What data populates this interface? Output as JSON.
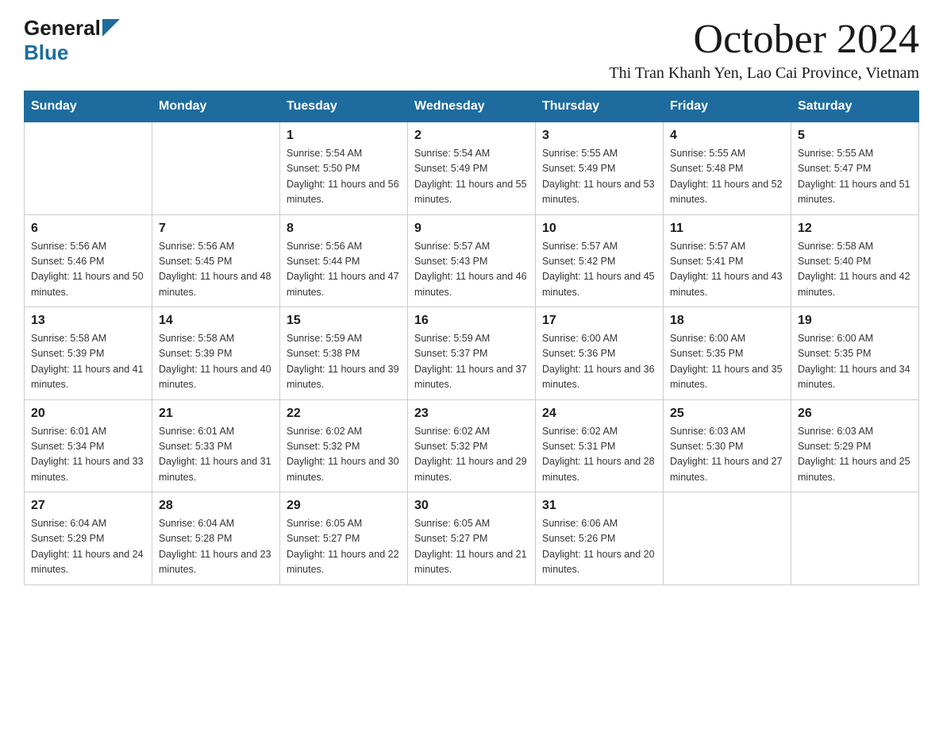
{
  "logo": {
    "general_text": "General",
    "blue_text": "Blue"
  },
  "header": {
    "month_title": "October 2024",
    "location": "Thi Tran Khanh Yen, Lao Cai Province, Vietnam"
  },
  "days_of_week": [
    "Sunday",
    "Monday",
    "Tuesday",
    "Wednesday",
    "Thursday",
    "Friday",
    "Saturday"
  ],
  "weeks": [
    [
      {
        "day": "",
        "sunrise": "",
        "sunset": "",
        "daylight": ""
      },
      {
        "day": "",
        "sunrise": "",
        "sunset": "",
        "daylight": ""
      },
      {
        "day": "1",
        "sunrise": "Sunrise: 5:54 AM",
        "sunset": "Sunset: 5:50 PM",
        "daylight": "Daylight: 11 hours and 56 minutes."
      },
      {
        "day": "2",
        "sunrise": "Sunrise: 5:54 AM",
        "sunset": "Sunset: 5:49 PM",
        "daylight": "Daylight: 11 hours and 55 minutes."
      },
      {
        "day": "3",
        "sunrise": "Sunrise: 5:55 AM",
        "sunset": "Sunset: 5:49 PM",
        "daylight": "Daylight: 11 hours and 53 minutes."
      },
      {
        "day": "4",
        "sunrise": "Sunrise: 5:55 AM",
        "sunset": "Sunset: 5:48 PM",
        "daylight": "Daylight: 11 hours and 52 minutes."
      },
      {
        "day": "5",
        "sunrise": "Sunrise: 5:55 AM",
        "sunset": "Sunset: 5:47 PM",
        "daylight": "Daylight: 11 hours and 51 minutes."
      }
    ],
    [
      {
        "day": "6",
        "sunrise": "Sunrise: 5:56 AM",
        "sunset": "Sunset: 5:46 PM",
        "daylight": "Daylight: 11 hours and 50 minutes."
      },
      {
        "day": "7",
        "sunrise": "Sunrise: 5:56 AM",
        "sunset": "Sunset: 5:45 PM",
        "daylight": "Daylight: 11 hours and 48 minutes."
      },
      {
        "day": "8",
        "sunrise": "Sunrise: 5:56 AM",
        "sunset": "Sunset: 5:44 PM",
        "daylight": "Daylight: 11 hours and 47 minutes."
      },
      {
        "day": "9",
        "sunrise": "Sunrise: 5:57 AM",
        "sunset": "Sunset: 5:43 PM",
        "daylight": "Daylight: 11 hours and 46 minutes."
      },
      {
        "day": "10",
        "sunrise": "Sunrise: 5:57 AM",
        "sunset": "Sunset: 5:42 PM",
        "daylight": "Daylight: 11 hours and 45 minutes."
      },
      {
        "day": "11",
        "sunrise": "Sunrise: 5:57 AM",
        "sunset": "Sunset: 5:41 PM",
        "daylight": "Daylight: 11 hours and 43 minutes."
      },
      {
        "day": "12",
        "sunrise": "Sunrise: 5:58 AM",
        "sunset": "Sunset: 5:40 PM",
        "daylight": "Daylight: 11 hours and 42 minutes."
      }
    ],
    [
      {
        "day": "13",
        "sunrise": "Sunrise: 5:58 AM",
        "sunset": "Sunset: 5:39 PM",
        "daylight": "Daylight: 11 hours and 41 minutes."
      },
      {
        "day": "14",
        "sunrise": "Sunrise: 5:58 AM",
        "sunset": "Sunset: 5:39 PM",
        "daylight": "Daylight: 11 hours and 40 minutes."
      },
      {
        "day": "15",
        "sunrise": "Sunrise: 5:59 AM",
        "sunset": "Sunset: 5:38 PM",
        "daylight": "Daylight: 11 hours and 39 minutes."
      },
      {
        "day": "16",
        "sunrise": "Sunrise: 5:59 AM",
        "sunset": "Sunset: 5:37 PM",
        "daylight": "Daylight: 11 hours and 37 minutes."
      },
      {
        "day": "17",
        "sunrise": "Sunrise: 6:00 AM",
        "sunset": "Sunset: 5:36 PM",
        "daylight": "Daylight: 11 hours and 36 minutes."
      },
      {
        "day": "18",
        "sunrise": "Sunrise: 6:00 AM",
        "sunset": "Sunset: 5:35 PM",
        "daylight": "Daylight: 11 hours and 35 minutes."
      },
      {
        "day": "19",
        "sunrise": "Sunrise: 6:00 AM",
        "sunset": "Sunset: 5:35 PM",
        "daylight": "Daylight: 11 hours and 34 minutes."
      }
    ],
    [
      {
        "day": "20",
        "sunrise": "Sunrise: 6:01 AM",
        "sunset": "Sunset: 5:34 PM",
        "daylight": "Daylight: 11 hours and 33 minutes."
      },
      {
        "day": "21",
        "sunrise": "Sunrise: 6:01 AM",
        "sunset": "Sunset: 5:33 PM",
        "daylight": "Daylight: 11 hours and 31 minutes."
      },
      {
        "day": "22",
        "sunrise": "Sunrise: 6:02 AM",
        "sunset": "Sunset: 5:32 PM",
        "daylight": "Daylight: 11 hours and 30 minutes."
      },
      {
        "day": "23",
        "sunrise": "Sunrise: 6:02 AM",
        "sunset": "Sunset: 5:32 PM",
        "daylight": "Daylight: 11 hours and 29 minutes."
      },
      {
        "day": "24",
        "sunrise": "Sunrise: 6:02 AM",
        "sunset": "Sunset: 5:31 PM",
        "daylight": "Daylight: 11 hours and 28 minutes."
      },
      {
        "day": "25",
        "sunrise": "Sunrise: 6:03 AM",
        "sunset": "Sunset: 5:30 PM",
        "daylight": "Daylight: 11 hours and 27 minutes."
      },
      {
        "day": "26",
        "sunrise": "Sunrise: 6:03 AM",
        "sunset": "Sunset: 5:29 PM",
        "daylight": "Daylight: 11 hours and 25 minutes."
      }
    ],
    [
      {
        "day": "27",
        "sunrise": "Sunrise: 6:04 AM",
        "sunset": "Sunset: 5:29 PM",
        "daylight": "Daylight: 11 hours and 24 minutes."
      },
      {
        "day": "28",
        "sunrise": "Sunrise: 6:04 AM",
        "sunset": "Sunset: 5:28 PM",
        "daylight": "Daylight: 11 hours and 23 minutes."
      },
      {
        "day": "29",
        "sunrise": "Sunrise: 6:05 AM",
        "sunset": "Sunset: 5:27 PM",
        "daylight": "Daylight: 11 hours and 22 minutes."
      },
      {
        "day": "30",
        "sunrise": "Sunrise: 6:05 AM",
        "sunset": "Sunset: 5:27 PM",
        "daylight": "Daylight: 11 hours and 21 minutes."
      },
      {
        "day": "31",
        "sunrise": "Sunrise: 6:06 AM",
        "sunset": "Sunset: 5:26 PM",
        "daylight": "Daylight: 11 hours and 20 minutes."
      },
      {
        "day": "",
        "sunrise": "",
        "sunset": "",
        "daylight": ""
      },
      {
        "day": "",
        "sunrise": "",
        "sunset": "",
        "daylight": ""
      }
    ]
  ]
}
